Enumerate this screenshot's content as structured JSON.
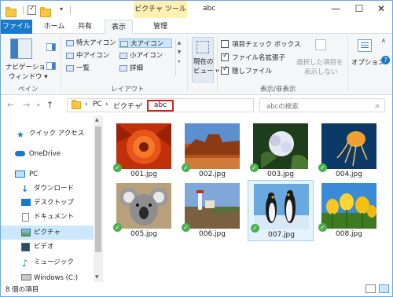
{
  "titlebar": {
    "context_tab": "ピクチャ ツール",
    "title": "abc",
    "qa_dropdown": "▾",
    "minimize": "—",
    "maximize": "☐",
    "close": "✕"
  },
  "tabs": {
    "file": "ファイル",
    "home": "ホーム",
    "share": "共有",
    "view": "表示",
    "manage": "管理"
  },
  "ribbon": {
    "pane": {
      "nav_pane_line1": "ナビゲーション",
      "nav_pane_line2": "ウィンドウ ▾",
      "label": "ペイン"
    },
    "layout": {
      "items": [
        "特大アイコン",
        "大アイコン",
        "中アイコン",
        "小アイコン",
        "一覧",
        "詳細"
      ],
      "selected": "大アイコン",
      "label": "レイアウト"
    },
    "current_view": {
      "line1": "現在の",
      "line2": "ビュー ▾"
    },
    "show_hide": {
      "item_checkbox": "項目チェック ボックス",
      "file_ext": "ファイル名拡張子",
      "hidden_files": "隠しファイル",
      "hide_selected_line1": "選択した項目を",
      "hide_selected_line2": "表示しない",
      "label": "表示/非表示"
    },
    "options": "オプション"
  },
  "address": {
    "segments": [
      "PC",
      "ピクチャ",
      "abc"
    ],
    "separator": "›",
    "current": "abc",
    "search_placeholder": "abcの検索"
  },
  "nav": {
    "items": [
      {
        "label": "クイック アクセス",
        "icon": "star-icon"
      },
      {
        "label": "OneDrive",
        "icon": "cloud-icon"
      },
      {
        "label": "PC",
        "icon": "pc-icon"
      },
      {
        "label": "ダウンロード",
        "icon": "download-icon"
      },
      {
        "label": "デスクトップ",
        "icon": "desktop-icon"
      },
      {
        "label": "ドキュメント",
        "icon": "documents-icon"
      },
      {
        "label": "ピクチャ",
        "icon": "pictures-icon"
      },
      {
        "label": "ビデオ",
        "icon": "videos-icon"
      },
      {
        "label": "ミュージック",
        "icon": "music-icon"
      },
      {
        "label": "Windows (C:)",
        "icon": "drive-icon"
      }
    ],
    "selected": "ピクチャ"
  },
  "files": [
    {
      "name": "001.jpg",
      "subject": "flower"
    },
    {
      "name": "002.jpg",
      "subject": "desert-canyon"
    },
    {
      "name": "003.jpg",
      "subject": "hydrangea"
    },
    {
      "name": "004.jpg",
      "subject": "jellyfish"
    },
    {
      "name": "005.jpg",
      "subject": "koala"
    },
    {
      "name": "006.jpg",
      "subject": "lighthouse"
    },
    {
      "name": "007.jpg",
      "subject": "penguins"
    },
    {
      "name": "008.jpg",
      "subject": "tulips"
    }
  ],
  "selected_file": "007.jpg",
  "status": {
    "count": "8 個の項目"
  },
  "colors": {
    "accent": "#1979ca",
    "highlight": "#d7201f",
    "selection": "#cce8ff",
    "context_tab": "#fff0b3"
  }
}
